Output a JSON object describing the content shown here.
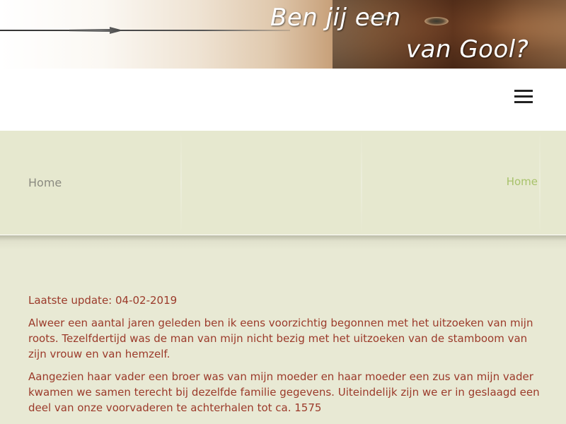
{
  "banner": {
    "title_line1": "Ben jij een",
    "title_line2": "van Gool?"
  },
  "nav": {
    "menu_icon": "hamburger-menu-icon"
  },
  "page_header": {
    "title": "Home",
    "breadcrumb_link": "Home",
    "breadcrumb_color": "#a8c26a"
  },
  "content": {
    "update": "Laatste update: 04-02-2019",
    "paragraph1": "Alweer een aantal jaren geleden ben ik eens voorzichtig begonnen met het uitzoeken van mijn roots. Tezelfdertijd was de man van mijn nicht bezig met het uitzoeken van de stamboom van zijn vrouw en van hemzelf.",
    "paragraph2": "Aangezien haar vader een broer was van mijn moeder en haar moeder een zus van mijn vader kwamen we samen terecht bij dezelfde familie gegevens. Uiteindelijk zijn we er in geslaagd een deel van onze voorvaderen te achterhalen tot ca. 1575",
    "text_color": "#9b3a2a"
  }
}
